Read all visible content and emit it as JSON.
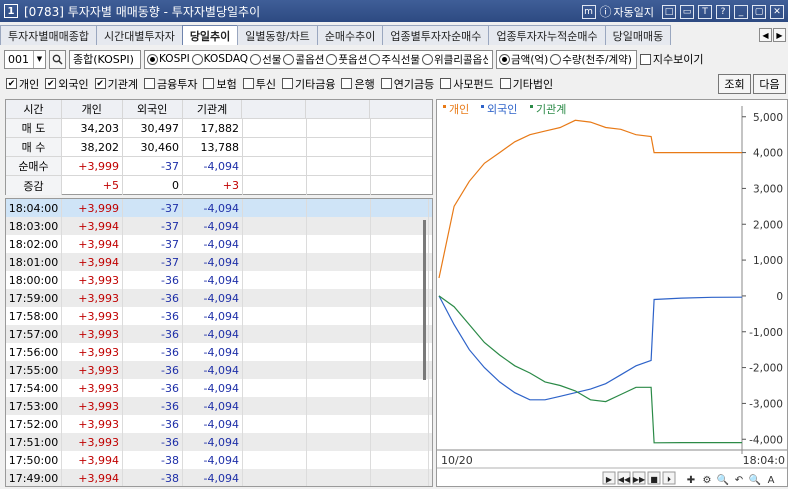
{
  "window": {
    "number": "1",
    "title": "[0783] 투자자별 매매동향 - 투자자별당일추이",
    "diary_label": "자동일지",
    "controls": [
      "m",
      "□",
      "▭",
      "T",
      "?",
      "_",
      "▢",
      "✕"
    ]
  },
  "tabs": [
    {
      "label": "투자자별매매종합",
      "active": false
    },
    {
      "label": "시간대별투자자",
      "active": false
    },
    {
      "label": "당일추이",
      "active": true
    },
    {
      "label": "일별동향/차트",
      "active": false
    },
    {
      "label": "순매수추이",
      "active": false
    },
    {
      "label": "업종별투자자순매수",
      "active": false
    },
    {
      "label": "업종투자자누적순매수",
      "active": false
    },
    {
      "label": "당일매매동",
      "active": false
    }
  ],
  "tab_nav": {
    "prev": "◀",
    "next": "▶"
  },
  "controls": {
    "code": "001",
    "market": "종합(KOSPI)",
    "market_radios": [
      {
        "label": "KOSPI",
        "on": true
      },
      {
        "label": "KOSDAQ",
        "on": false
      },
      {
        "label": "선물",
        "on": false
      },
      {
        "label": "콜옵션",
        "on": false
      },
      {
        "label": "풋옵션",
        "on": false
      },
      {
        "label": "주식선물",
        "on": false
      },
      {
        "label": "위클리콜옵션",
        "on": false
      }
    ],
    "unit_radios": [
      {
        "label": "금액(억)",
        "on": true
      },
      {
        "label": "수량(천주/계약)",
        "on": false
      }
    ],
    "index_view": "지수보이기",
    "investors": [
      {
        "label": "개인",
        "on": true
      },
      {
        "label": "외국인",
        "on": true
      },
      {
        "label": "기관계",
        "on": true
      },
      {
        "label": "금융투자",
        "on": false
      },
      {
        "label": "보험",
        "on": false
      },
      {
        "label": "투신",
        "on": false
      },
      {
        "label": "기타금융",
        "on": false
      },
      {
        "label": "은행",
        "on": false
      },
      {
        "label": "연기금등",
        "on": false
      },
      {
        "label": "사모펀드",
        "on": false
      },
      {
        "label": "기타법인",
        "on": false
      }
    ],
    "search_button": "조회",
    "next_button": "다음"
  },
  "summary": {
    "headers": [
      "시간",
      "개인",
      "외국인",
      "기관계"
    ],
    "rows": [
      {
        "label": "매 도",
        "values": [
          "34,203",
          "30,497",
          "17,882"
        ]
      },
      {
        "label": "매 수",
        "values": [
          "38,202",
          "30,460",
          "13,788"
        ]
      },
      {
        "label": "순매수",
        "values": [
          "+3,999",
          "-37",
          "-4,094"
        ]
      },
      {
        "label": "증감",
        "values": [
          "+5",
          "0",
          "+3"
        ]
      }
    ]
  },
  "time_rows": [
    [
      "18:04:00",
      "+3,999",
      "-37",
      "-4,094"
    ],
    [
      "18:03:00",
      "+3,994",
      "-37",
      "-4,094"
    ],
    [
      "18:02:00",
      "+3,994",
      "-37",
      "-4,094"
    ],
    [
      "18:01:00",
      "+3,994",
      "-37",
      "-4,094"
    ],
    [
      "18:00:00",
      "+3,993",
      "-36",
      "-4,094"
    ],
    [
      "17:59:00",
      "+3,993",
      "-36",
      "-4,094"
    ],
    [
      "17:58:00",
      "+3,993",
      "-36",
      "-4,094"
    ],
    [
      "17:57:00",
      "+3,993",
      "-36",
      "-4,094"
    ],
    [
      "17:56:00",
      "+3,993",
      "-36",
      "-4,094"
    ],
    [
      "17:55:00",
      "+3,993",
      "-36",
      "-4,094"
    ],
    [
      "17:54:00",
      "+3,993",
      "-36",
      "-4,094"
    ],
    [
      "17:53:00",
      "+3,993",
      "-36",
      "-4,094"
    ],
    [
      "17:52:00",
      "+3,993",
      "-36",
      "-4,094"
    ],
    [
      "17:51:00",
      "+3,993",
      "-36",
      "-4,094"
    ],
    [
      "17:50:00",
      "+3,994",
      "-38",
      "-4,094"
    ],
    [
      "17:49:00",
      "+3,994",
      "-38",
      "-4,094"
    ]
  ],
  "colors": {
    "individual": "#e87a17",
    "foreign": "#2e63c9",
    "institution": "#2b8a47",
    "positive": "#c00000",
    "negative": "#1e2fa8"
  },
  "chart_data": {
    "type": "line",
    "legend": [
      "개인",
      "외국인",
      "기관계"
    ],
    "x_start_label": "10/20",
    "x_end_label": "18:04:0",
    "ylim": [
      -4300,
      5300
    ],
    "yticks": [
      5000,
      4000,
      3000,
      2000,
      1000,
      0,
      -1000,
      -2000,
      -3000,
      -4000
    ],
    "ytick_labels": [
      "5,000",
      "4,000",
      "3,000",
      "2,000",
      "1,000",
      "0",
      "-1,000",
      "-2,000",
      "-3,000",
      "-4,000"
    ],
    "x": [
      0,
      0.05,
      0.1,
      0.15,
      0.2,
      0.25,
      0.3,
      0.35,
      0.4,
      0.45,
      0.5,
      0.55,
      0.6,
      0.65,
      0.7,
      0.71,
      0.8,
      0.9,
      1.0
    ],
    "series": [
      {
        "name": "개인",
        "values": [
          500,
          2500,
          3200,
          3700,
          4000,
          4300,
          4500,
          4600,
          4700,
          4900,
          4850,
          4700,
          4650,
          4500,
          4450,
          4000,
          4000,
          4000,
          4000
        ]
      },
      {
        "name": "외국인",
        "values": [
          0,
          -800,
          -1500,
          -2000,
          -2400,
          -2700,
          -2900,
          -2900,
          -2800,
          -2700,
          -2600,
          -2450,
          -2200,
          -1950,
          -1800,
          -100,
          -60,
          -40,
          -37
        ]
      },
      {
        "name": "기관계",
        "values": [
          0,
          -300,
          -800,
          -1300,
          -1650,
          -1950,
          -2150,
          -2400,
          -2500,
          -2650,
          -2900,
          -2950,
          -2750,
          -2550,
          -2550,
          -4100,
          -4094,
          -4094,
          -4094
        ]
      }
    ]
  }
}
